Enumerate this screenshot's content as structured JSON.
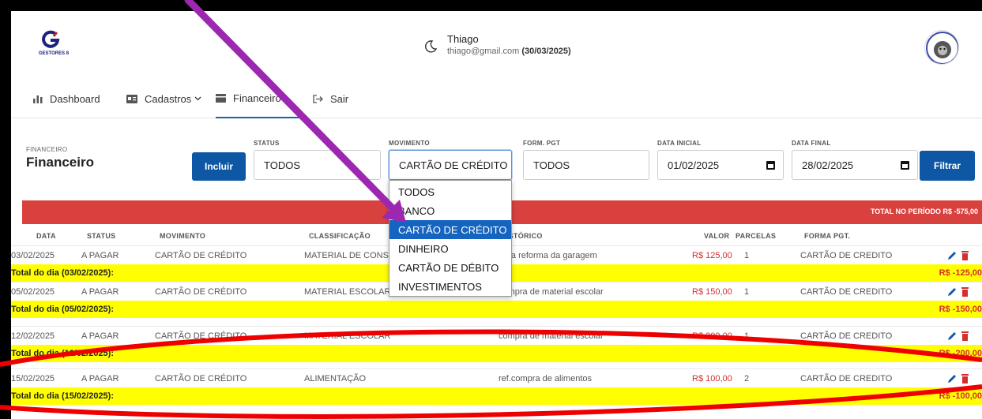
{
  "header": {
    "logo_text": "GESTORES 8",
    "user_name": "Thiago",
    "user_email": "thiago@gmail.com",
    "user_date": "(30/03/2025)"
  },
  "nav": {
    "items": [
      {
        "label": "Dashboard",
        "icon": "bar-chart-icon"
      },
      {
        "label": "Cadastros",
        "icon": "id-card-icon"
      },
      {
        "label": "Financeiro",
        "icon": "wallet-icon"
      },
      {
        "label": "Sair",
        "icon": "logout-icon"
      }
    ]
  },
  "filters": {
    "breadcrumb": "FINANCEIRO",
    "title": "Financeiro",
    "include_label": "Incluir",
    "filter_label": "Filtrar",
    "status": {
      "label": "STATUS",
      "value": "TODOS"
    },
    "movimento": {
      "label": "MOVIMENTO",
      "value": "CARTÃO DE CRÉDITO"
    },
    "form_pgt": {
      "label": "FORM. PGT",
      "value": "TODOS"
    },
    "data_inicial": {
      "label": "DATA INICIAL",
      "value": "01/02/2025"
    },
    "data_final": {
      "label": "DATA FINAL",
      "value": "28/02/2025"
    }
  },
  "dropdown": {
    "options": [
      "TODOS",
      "BANCO",
      "CARTÃO DE CRÉDITO",
      "DINHEIRO",
      "CARTÃO DE DÉBITO",
      "INVESTIMENTOS"
    ],
    "selected": "CARTÃO DE CRÉDITO"
  },
  "table": {
    "total_period": "TOTAL NO PERÍODO R$ -575,00",
    "headers": [
      "DATA",
      "STATUS",
      "MOVIMENTO",
      "CLASSIFICAÇÃO",
      "HISTÓRICO",
      "VALOR",
      "PARCELAS",
      "FORMA PGT."
    ],
    "rows": [
      {
        "data": "03/02/2025",
        "status": "A PAGAR",
        "movimento": "CARTÃO DE CRÉDITO",
        "classificacao": "MATERIAL DE CONS",
        "historico": "ref.a reforma da garagem",
        "valor": "R$ 125,00",
        "parcelas": "1",
        "forma": "CARTÃO DE CREDITO",
        "total_label": "Total do dia (03/02/2025):",
        "total_value": "R$ -125,00"
      },
      {
        "data": "05/02/2025",
        "status": "A PAGAR",
        "movimento": "CARTÃO DE CRÉDITO",
        "classificacao": "MATERIAL ESCOLAR",
        "historico": "compra de material escolar",
        "valor": "R$ 150,00",
        "parcelas": "1",
        "forma": "CARTÃO DE CREDITO",
        "total_label": "Total do dia (05/02/2025):",
        "total_value": "R$ -150,00"
      },
      {
        "data": "12/02/2025",
        "status": "A PAGAR",
        "movimento": "CARTÃO DE CRÉDITO",
        "classificacao": "MATERIAL ESCOLAR",
        "historico": "compra de material escolar",
        "valor": "R$ 200,00",
        "parcelas": "1",
        "forma": "CARTÃO DE CREDITO",
        "total_label": "Total do dia (12/02/2025):",
        "total_value": "R$ -200,00"
      },
      {
        "data": "15/02/2025",
        "status": "A PAGAR",
        "movimento": "CARTÃO DE CRÉDITO",
        "classificacao": "ALIMENTAÇÃO",
        "historico": "ref.compra de alimentos",
        "valor": "R$ 100,00",
        "parcelas": "2",
        "forma": "CARTÃO DE CREDITO",
        "total_label": "Total do dia (15/02/2025):",
        "total_value": "R$ -100,00"
      }
    ]
  },
  "colors": {
    "primary": "#0d57a5",
    "banner": "#d9413f",
    "daily_total_bg": "#ffff00",
    "value_red": "#d32f2f",
    "arrow": "#9c27b0",
    "ellipse": "#ee0000"
  }
}
